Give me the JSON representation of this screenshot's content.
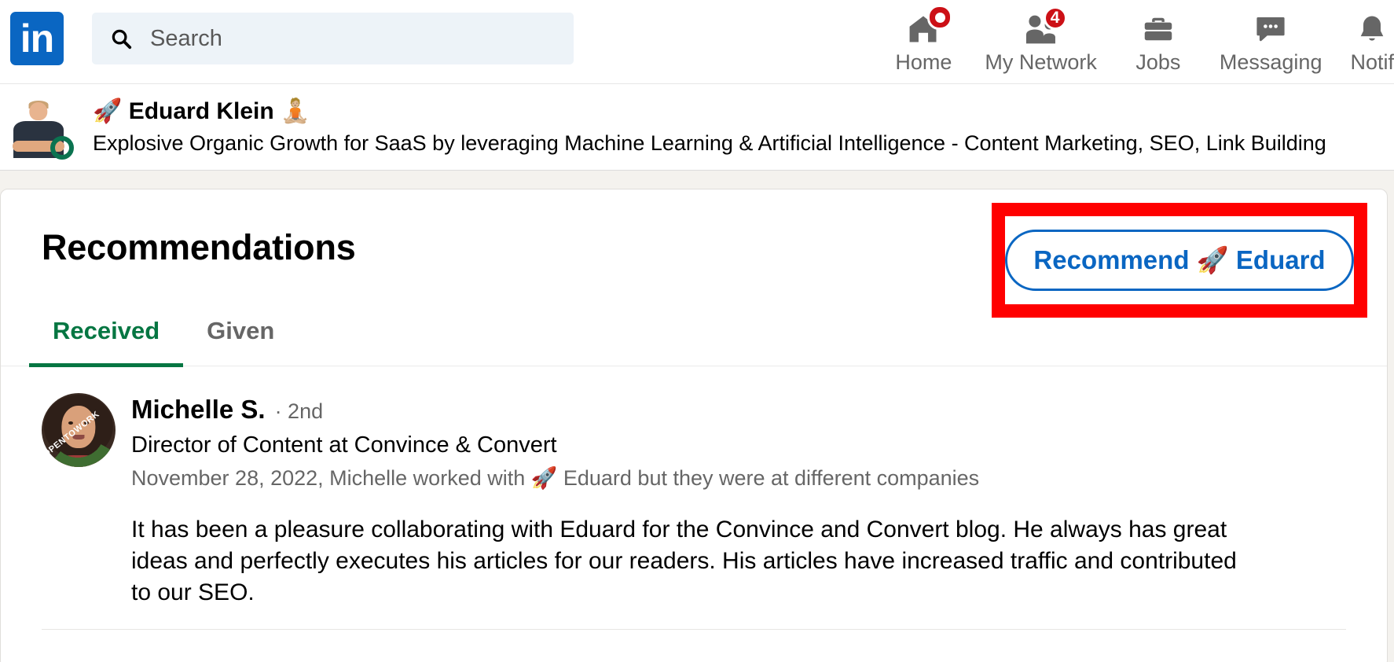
{
  "nav": {
    "logo_text": "in",
    "search": {
      "placeholder": "Search",
      "value": "",
      "icon": "search-icon"
    },
    "items": [
      {
        "label": "Home",
        "icon": "home-icon",
        "badge": "",
        "badge_type": "dot"
      },
      {
        "label": "My Network",
        "icon": "my-network-icon",
        "badge": "4",
        "badge_type": "count"
      },
      {
        "label": "Jobs",
        "icon": "briefcase-icon",
        "badge": "",
        "badge_type": "none"
      },
      {
        "label": "Messaging",
        "icon": "message-bubble-icon",
        "badge": "",
        "badge_type": "none"
      },
      {
        "label": "Notif",
        "icon": "bell-icon",
        "badge": "",
        "badge_type": "none"
      }
    ]
  },
  "profile_bar": {
    "avatar_alt": "Eduard Klein profile photo",
    "open_to_work_ring": true,
    "name": "🚀 Eduard Klein 🧘🏼",
    "headline": "Explosive Organic Growth for SaaS by leveraging Machine Learning & Artificial Intelligence - Content Marketing, SEO, Link Building"
  },
  "recommendations": {
    "title": "Recommendations",
    "recommend_button_label": "Recommend 🚀 Eduard",
    "tabs": [
      {
        "label": "Received",
        "active": true
      },
      {
        "label": "Given",
        "active": false
      }
    ],
    "items": [
      {
        "avatar_alt": "Michelle S. profile photo",
        "open_to_work_band": "#OPENTOWORK",
        "name": "Michelle S.",
        "degree": "· 2nd",
        "title": "Director of Content at Convince & Convert",
        "meta": "November 28, 2022, Michelle worked with 🚀 Eduard but they were at different companies",
        "text": "It has been a pleasure collaborating with Eduard for the Convince and Convert blog. He always has great ideas and perfectly executes his articles for our readers. His articles have increased traffic and contributed to our SEO."
      }
    ]
  },
  "colors": {
    "brand_blue": "#0a66c2",
    "active_green": "#057642",
    "badge_red": "#cc1016",
    "highlight_red": "#ff0000",
    "page_bg": "#f4f2ee"
  }
}
